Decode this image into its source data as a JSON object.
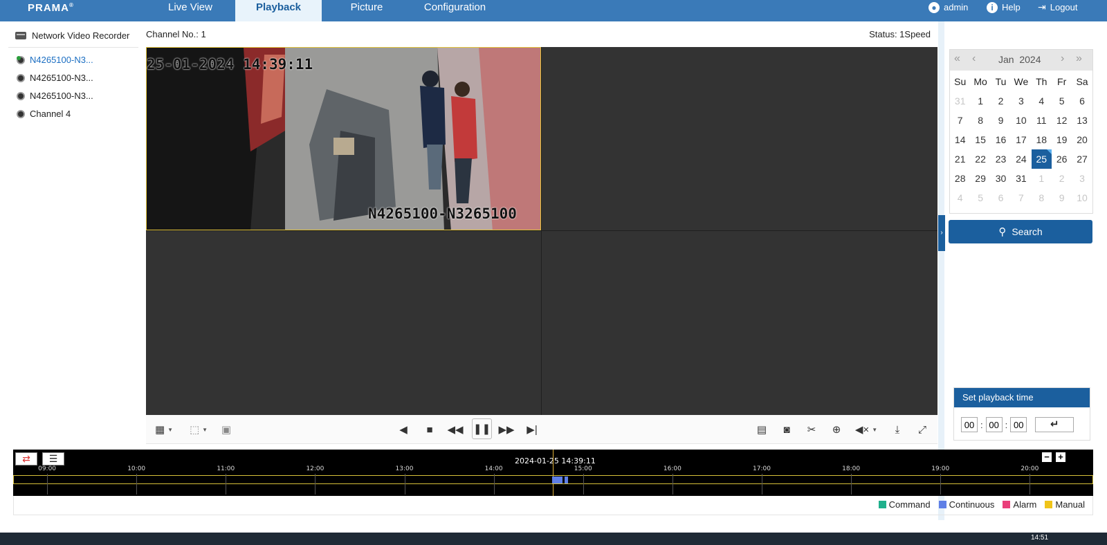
{
  "brand": {
    "logo_text": "PRAMA"
  },
  "nav": {
    "tabs": [
      {
        "label": "Live View"
      },
      {
        "label": "Playback"
      },
      {
        "label": "Picture"
      },
      {
        "label": "Configuration"
      }
    ],
    "active_tab": "Playback",
    "user": "admin",
    "help": "Help",
    "logout": "Logout"
  },
  "tree": {
    "root": "Network Video Recorder",
    "items": [
      {
        "label": "N4265100-N3..."
      },
      {
        "label": "N4265100-N3..."
      },
      {
        "label": "N4265100-N3..."
      },
      {
        "label": "Channel 4"
      }
    ],
    "selected_index": 0
  },
  "player": {
    "channel_label": "Channel No.: 1",
    "status_label": "Status: 1Speed",
    "osd_timestamp": "25-01-2024 14:39:11",
    "osd_camera_name": "N4265100-N3265100"
  },
  "calendar": {
    "month": "Jan",
    "year": "2024",
    "weekdays": [
      "Su",
      "Mo",
      "Tu",
      "We",
      "Th",
      "Fr",
      "Sa"
    ],
    "weeks": [
      [
        "31",
        "1",
        "2",
        "3",
        "4",
        "5",
        "6"
      ],
      [
        "7",
        "8",
        "9",
        "10",
        "11",
        "12",
        "13"
      ],
      [
        "14",
        "15",
        "16",
        "17",
        "18",
        "19",
        "20"
      ],
      [
        "21",
        "22",
        "23",
        "24",
        "25",
        "26",
        "27"
      ],
      [
        "28",
        "29",
        "30",
        "31",
        "1",
        "2",
        "3"
      ],
      [
        "4",
        "5",
        "6",
        "7",
        "8",
        "9",
        "10"
      ]
    ],
    "selected_day": "25",
    "search_label": "Search"
  },
  "playback_time": {
    "title": "Set playback time",
    "hh": "00",
    "mm": "00",
    "ss": "00"
  },
  "timeline": {
    "current": "2024-01-25 14:39:11",
    "ticks": [
      "09:00",
      "10:00",
      "11:00",
      "12:00",
      "13:00",
      "14:00",
      "15:00",
      "16:00",
      "17:00",
      "18:00",
      "19:00",
      "20:00"
    ],
    "range_start_hour": 8.62,
    "range_end_hour": 20.71,
    "recordings": [
      {
        "start_hour": 14.65,
        "end_hour": 14.77,
        "type": "Continuous"
      },
      {
        "start_hour": 14.79,
        "end_hour": 14.83,
        "type": "Continuous"
      }
    ]
  },
  "legend": [
    {
      "label": "Command",
      "color": "#1fb08c"
    },
    {
      "label": "Continuous",
      "color": "#5f7fe6"
    },
    {
      "label": "Alarm",
      "color": "#ea3f7a"
    },
    {
      "label": "Manual",
      "color": "#f0c419"
    }
  ],
  "taskbar": {
    "clock": "14:51"
  },
  "colors": {
    "nav_bg": "#3a7ab8",
    "accent": "#1b5f9e"
  }
}
